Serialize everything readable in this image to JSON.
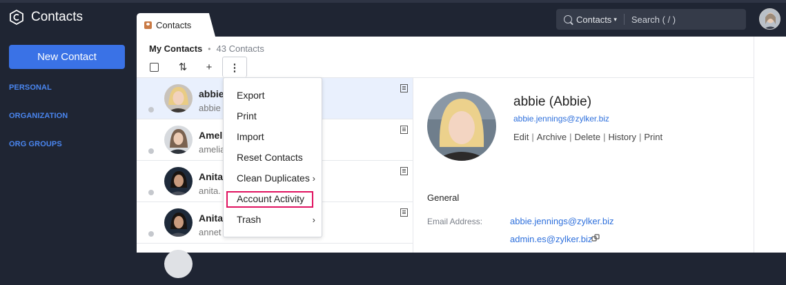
{
  "app": {
    "title": "Contacts"
  },
  "sidebar": {
    "new_button": "New Contact",
    "items": [
      {
        "label": "PERSONAL"
      },
      {
        "label": "ORGANIZATION"
      },
      {
        "label": "ORG GROUPS"
      }
    ]
  },
  "tab": {
    "label": "Contacts"
  },
  "search": {
    "scope": "Contacts",
    "placeholder": "Search ( / )"
  },
  "list": {
    "title": "My Contacts",
    "count": "43 Contacts",
    "rows": [
      {
        "name": "abbie",
        "email": "abbie"
      },
      {
        "name": "Ameli",
        "email": "amelia"
      },
      {
        "name": "Anita",
        "email": "anita."
      },
      {
        "name": "Anita",
        "email": "annet"
      }
    ]
  },
  "menu": {
    "items": [
      {
        "label": "Export"
      },
      {
        "label": "Print"
      },
      {
        "label": "Import"
      },
      {
        "label": "Reset Contacts"
      },
      {
        "label": "Clean Duplicates",
        "submenu": true
      },
      {
        "label": "Account Activity",
        "highlighted": true
      },
      {
        "label": "Trash",
        "submenu": true
      }
    ]
  },
  "detail": {
    "name": "abbie (Abbie)",
    "email": "abbie.jennings@zylker.biz",
    "actions": [
      "Edit",
      "Archive",
      "Delete",
      "History",
      "Print"
    ],
    "section": "General",
    "email_label": "Email Address:",
    "emails": [
      "abbie.jennings@zylker.biz",
      "admin.es@zylker.biz"
    ]
  },
  "colors": {
    "sidebar_bg": "#1f2533",
    "accent": "#3a72e6",
    "nav_text": "#4a86f0",
    "highlight_border": "#e0115f",
    "selected_row": "#e9f0fd"
  }
}
